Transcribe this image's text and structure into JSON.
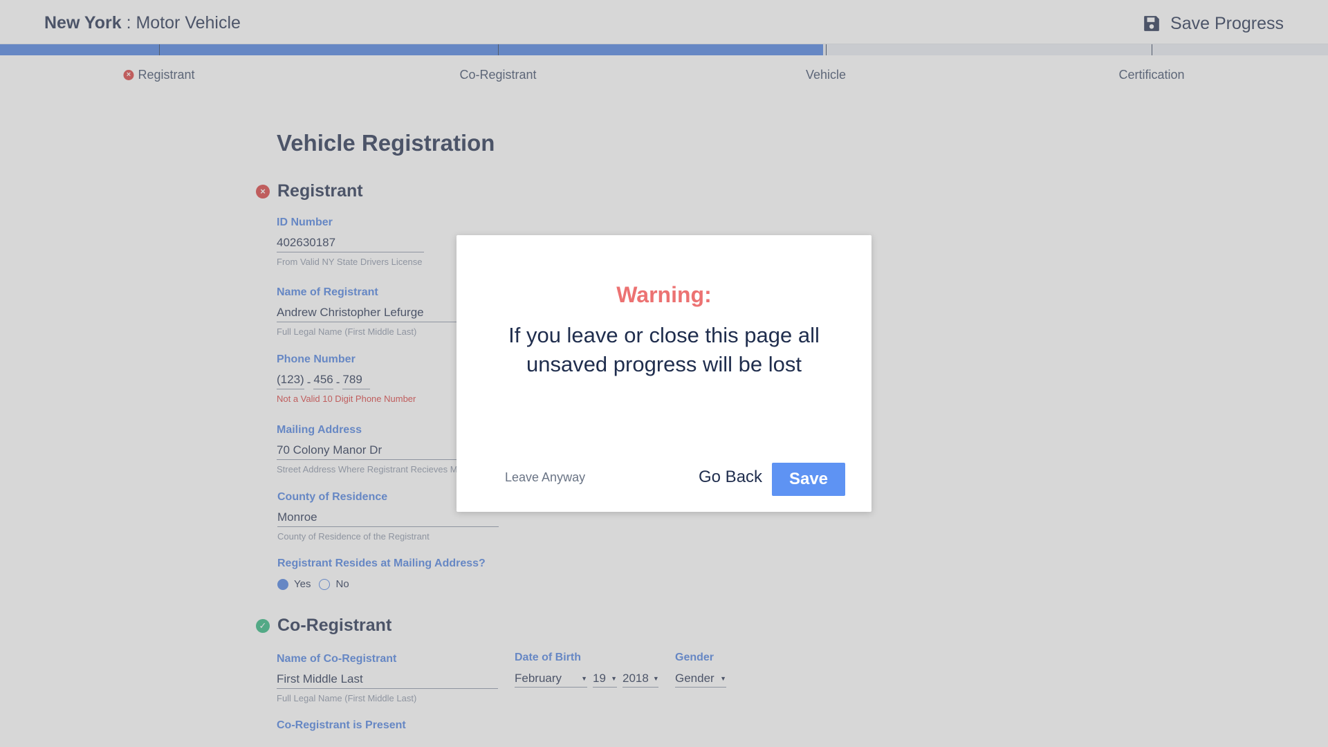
{
  "header": {
    "brand_state": "New York",
    "brand_separator": " : ",
    "brand_agency": "Motor Vehicle",
    "save_progress_label": "Save Progress",
    "save_icon": "floppy-disk-icon"
  },
  "progress": {
    "fraction": 0.62,
    "steps": [
      {
        "label": "Registrant",
        "status": "error"
      },
      {
        "label": "Co-Registrant",
        "status": "none"
      },
      {
        "label": "Vehicle",
        "status": "none"
      },
      {
        "label": "Certification",
        "status": "none"
      }
    ]
  },
  "form": {
    "title": "Vehicle Registration",
    "registrant": {
      "heading": "Registrant",
      "status": "error",
      "id_label": "ID Number",
      "id_value": "402630187",
      "id_hint": "From Valid NY State Drivers License",
      "name_label": "Name of Registrant",
      "name_value": "Andrew Christopher Lefurge",
      "name_hint": "Full Legal Name (First Middle Last)",
      "phone_label": "Phone Number",
      "phone_area": "(123)",
      "phone_sep": "-",
      "phone_prefix": "456",
      "phone_sep2": "-",
      "phone_line": "789",
      "phone_hint": "Not a Valid 10 Digit Phone Number",
      "mail_label": "Mailing Address",
      "mail_value": "70 Colony Manor Dr",
      "mail_hint": "Street Address Where Registrant Recieves M",
      "county_label": "County of Residence",
      "county_value": "Monroe",
      "county_hint": "County of Residence of the Registrant",
      "resides_label": "Registrant Resides at Mailing Address?",
      "resides_yes": "Yes",
      "resides_no": "No"
    },
    "coregistrant": {
      "heading": "Co-Registrant",
      "status": "ok",
      "name_label": "Name of Co-Registrant",
      "name_value": "First Middle Last",
      "name_hint": "Full Legal Name (First Middle Last)",
      "dob_label": "Date of Birth",
      "dob_month": "February",
      "dob_day": "19",
      "dob_year": "2018",
      "gender_label": "Gender",
      "gender_value": "Gender",
      "present_label": "Co-Registrant is Present"
    }
  },
  "dialog": {
    "title": "Warning:",
    "message": "If you leave or close this page all unsaved progress will be lost",
    "leave_label": "Leave Anyway",
    "goback_label": "Go Back",
    "save_label": "Save"
  },
  "colors": {
    "accent": "#4a7fe0",
    "error": "#d93a3a",
    "success": "#2bb57c",
    "warning_title": "#ec7272",
    "primary_button": "#5e93f3"
  }
}
